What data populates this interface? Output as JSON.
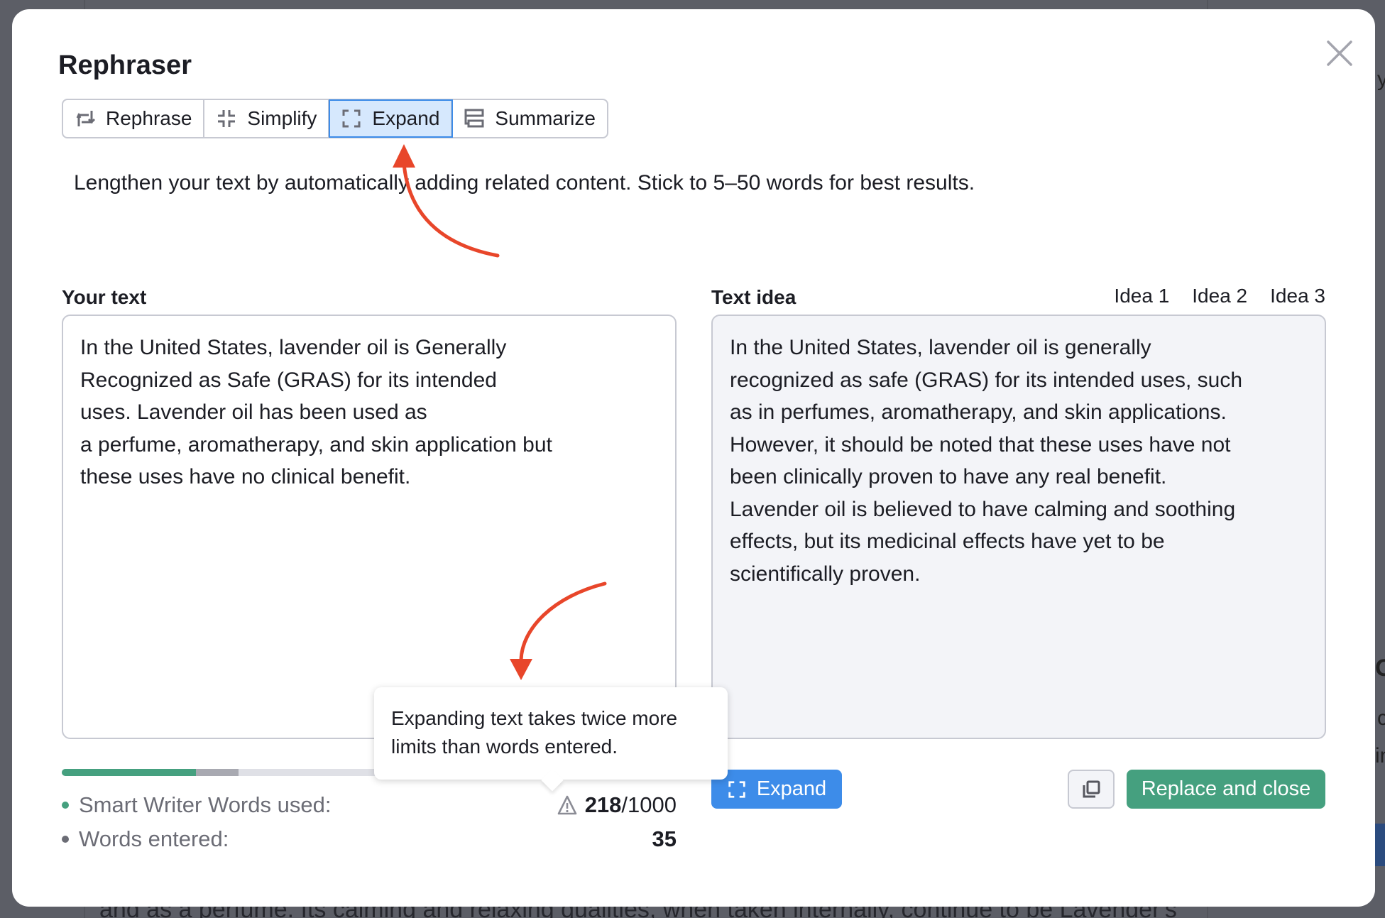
{
  "dialog": {
    "title": "Rephraser",
    "close_icon": "close-icon",
    "modes": [
      {
        "label": "Rephrase",
        "icon": "rephrase-icon",
        "active": false
      },
      {
        "label": "Simplify",
        "icon": "simplify-icon",
        "active": false
      },
      {
        "label": "Expand",
        "icon": "expand-icon",
        "active": true
      },
      {
        "label": "Summarize",
        "icon": "summarize-icon",
        "active": false
      }
    ],
    "description": "Lengthen your text by automatically adding related content. Stick to 5–50 words for best results."
  },
  "input": {
    "label": "Your text",
    "lines": [
      "In the United States, lavender oil is Generally",
      "Recognized as Safe (GRAS) for its intended",
      "uses. Lavender oil has been used as",
      "a perfume, aromatherapy, and skin application but",
      "these uses have no clinical benefit."
    ]
  },
  "output": {
    "label": "Text idea",
    "tabs": [
      {
        "label": "Idea 1",
        "active": true
      },
      {
        "label": "Idea 2",
        "active": false
      },
      {
        "label": "Idea 3",
        "active": false
      }
    ],
    "lines": [
      "In the United States, lavender oil is generally",
      "recognized as safe (GRAS) for its intended uses, such",
      "as in perfumes, aromatherapy, and skin applications.",
      "However, it should be noted that these uses have not",
      "been clinically proven to have any real benefit.",
      "Lavender oil is believed to have calming and soothing",
      "effects, but its medicinal effects have yet to be",
      "scientifically proven."
    ]
  },
  "usage": {
    "progress_used_fraction": 0.218,
    "progress_pending_fraction": 0.07,
    "words_used_label": "Smart Writer Words used:",
    "words_used": "218",
    "words_limit": "/1000",
    "warning_icon": "warning-icon",
    "words_entered_label": "Words entered:",
    "words_entered": "35"
  },
  "tooltip": {
    "line1": "Expanding text takes twice more",
    "line2": "limits than words entered."
  },
  "actions": {
    "expand_label": "Expand",
    "copy_icon": "copy-icon",
    "replace_label": "Replace and close"
  },
  "colors": {
    "accent_blue": "#3d8ce9",
    "accent_green": "#45a07f",
    "annotation_red": "#e8462a"
  },
  "background_page": {
    "snippet": "and as a perfume. Its calming and relaxing qualities, when taken internally, continue to be Lavender's"
  }
}
